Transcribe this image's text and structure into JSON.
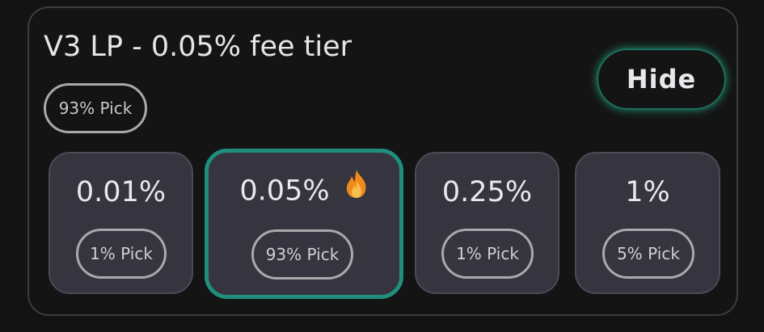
{
  "card": {
    "title": "V3 LP - 0.05% fee tier",
    "header_pick": "93% Pick",
    "hide_label": "Hide"
  },
  "tiers": [
    {
      "percent": "0.01%",
      "pick": "1% Pick",
      "selected": false,
      "icon": null
    },
    {
      "percent": "0.05%",
      "pick": "93% Pick",
      "selected": true,
      "icon": "fire-icon"
    },
    {
      "percent": "0.25%",
      "pick": "1% Pick",
      "selected": false,
      "icon": null
    },
    {
      "percent": "1%",
      "pick": "5% Pick",
      "selected": false,
      "icon": null
    }
  ],
  "colors": {
    "background": "#131313",
    "tile": "#35343f",
    "accent": "#1f8f7c",
    "pill_border": "#a9a9ad"
  }
}
